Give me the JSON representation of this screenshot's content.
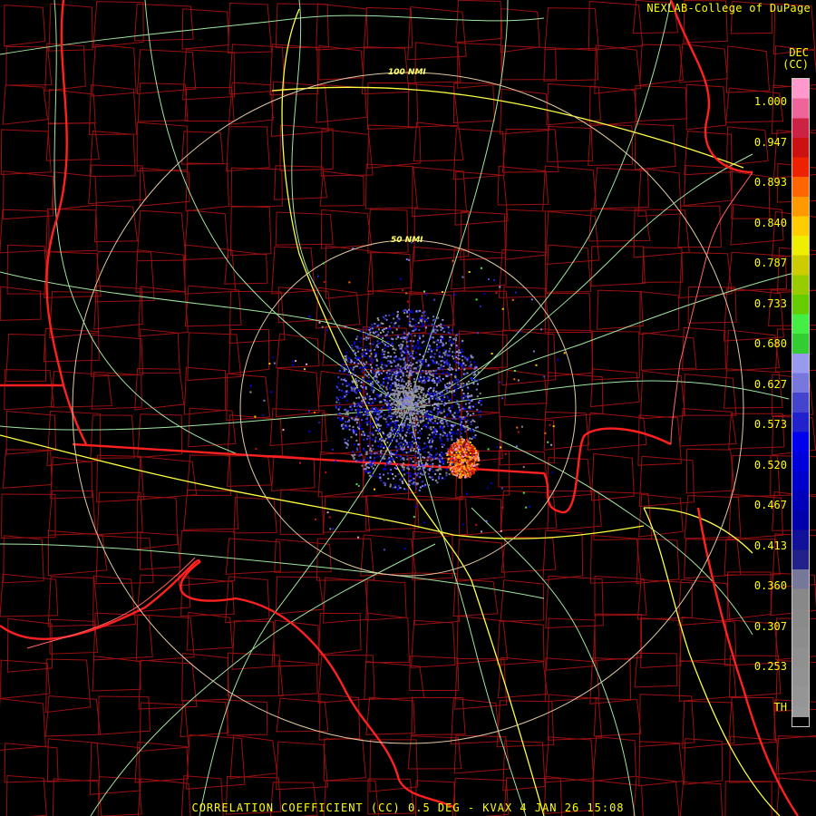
{
  "credit": "NEXLAB-College of DuPage",
  "product": {
    "title": "CORRELATION COEFFICIENT (CC) 0.5 DEG - KVAX 4 JAN 26 15:08",
    "unit_line1": "DEC",
    "unit_line2": "(CC)"
  },
  "range_rings": [
    {
      "label": "100 NMI"
    },
    {
      "label": "50 NMI"
    }
  ],
  "legend": {
    "labels": [
      "1.000",
      "0.947",
      "0.893",
      "0.840",
      "0.787",
      "0.733",
      "0.680",
      "0.627",
      "0.573",
      "0.520",
      "0.467",
      "0.413",
      "0.360",
      "0.307",
      "0.253",
      "TH"
    ],
    "colors": [
      "#ff99cc",
      "#ee6699",
      "#cc2244",
      "#cc1111",
      "#ee2200",
      "#ff6600",
      "#ff9900",
      "#ffcc00",
      "#eeee00",
      "#cccc00",
      "#99cc00",
      "#66cc00",
      "#44ee44",
      "#33cc33",
      "#9999ee",
      "#7777dd",
      "#4444cc",
      "#2222cc",
      "#0000ee",
      "#0000dd",
      "#0000cc",
      "#0000bb",
      "#0000aa",
      "#111199",
      "#222288",
      "#777799",
      "#888888",
      "#8a8a8a",
      "#8c8c8c",
      "#909090",
      "#929292",
      "#959595",
      "#999999"
    ]
  },
  "colors": {
    "background": "#000000",
    "text": "#ffff00",
    "state_line": "#ff2020",
    "county_line": "#a01010",
    "highway": "#ffff40",
    "road": "#a0f0a0",
    "range_ring": "#e0c8a0"
  }
}
